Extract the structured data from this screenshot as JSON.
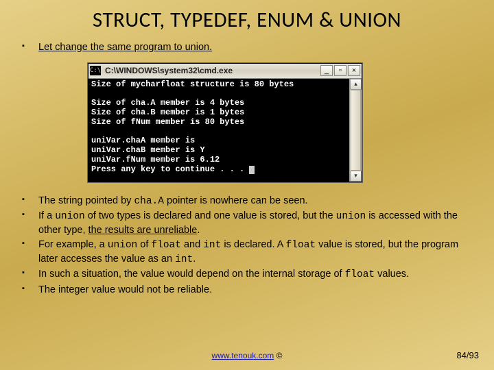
{
  "heading": "STRUCT, TYPEDEF, ENUM & UNION",
  "intro": {
    "text": "Let change the same program to union."
  },
  "cmd": {
    "sys_label": "C:\\",
    "title": "C:\\WINDOWS\\system32\\cmd.exe",
    "btn_min": "_",
    "btn_max": "▫",
    "btn_close": "×",
    "scroll_up": "▴",
    "scroll_down": "▾",
    "lines": {
      "l1": "Size of mycharfloat structure is 80 bytes",
      "l2": "",
      "l3": "Size of cha.A member is 4 bytes",
      "l4": "Size of cha.B member is 1 bytes",
      "l5": "Size of fNum member is 80 bytes",
      "l6": "",
      "l7": "uniVar.chaA member is",
      "l8": "uniVar.chaB member is Y",
      "l9": "uniVar.fNum member is 6.12",
      "l10": "Press any key to continue . . . "
    }
  },
  "bullets": {
    "b1_a": "The string pointed by ",
    "b1_code": "cha.A",
    "b1_b": " pointer is nowhere can be seen.",
    "b2_a": "If a ",
    "b2_code1": "union",
    "b2_b": " of two types is declared and one value is stored, but the ",
    "b2_code2": "union",
    "b2_c": " is accessed with the other type, ",
    "b2_u": "the results are unreliable",
    "b2_d": ".",
    "b3_a": "For example, a ",
    "b3_code1": "union",
    "b3_b": " of ",
    "b3_code2": "float",
    "b3_c": " and ",
    "b3_code3": "int",
    "b3_d": " is declared. A ",
    "b3_code4": "float",
    "b3_e": " value is stored, but the program later accesses the value as an ",
    "b3_code5": "int",
    "b3_f": ".",
    "b4_a": "In such a situation, the value would depend on the internal storage of ",
    "b4_code": "float",
    "b4_b": " values.",
    "b5": "The integer value would not be reliable."
  },
  "footer": {
    "url_text": "www.tenouk.com",
    "copy": " ©"
  },
  "page": "84/93"
}
